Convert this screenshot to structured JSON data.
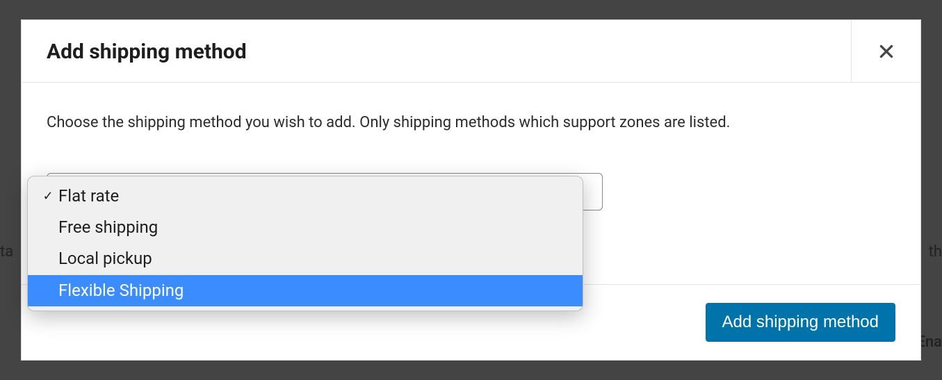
{
  "modal": {
    "title": "Add shipping method",
    "instruction": "Choose the shipping method you wish to add. Only shipping methods which support zones are listed.",
    "close_label": "Close"
  },
  "select": {
    "selected_index": 0,
    "highlighted_index": 3,
    "options": [
      {
        "label": "Flat rate"
      },
      {
        "label": "Free shipping"
      },
      {
        "label": "Local pickup"
      },
      {
        "label": "Flexible Shipping"
      }
    ]
  },
  "footer": {
    "add_button": "Add shipping method"
  },
  "background": {
    "left": "ta",
    "right1": "th",
    "right2": "Ena"
  }
}
